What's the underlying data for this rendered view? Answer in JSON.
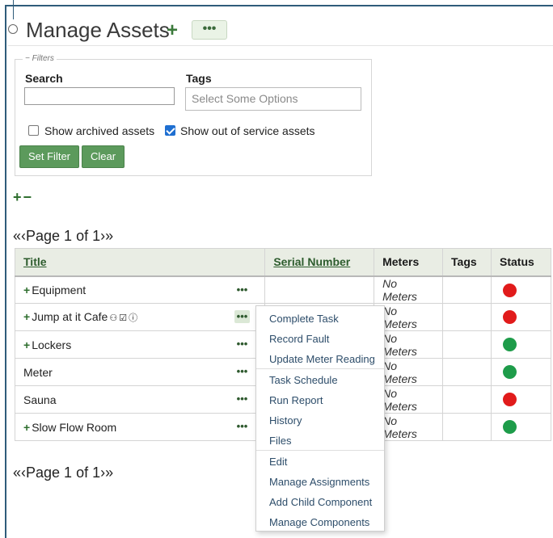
{
  "header": {
    "title": "Manage Assets",
    "add_symbol": "+",
    "more_symbol": "•••"
  },
  "filters": {
    "legend": "Filters",
    "search_label": "Search",
    "search_value": "",
    "tags_label": "Tags",
    "tags_placeholder": "Select Some Options",
    "show_archived_label": "Show archived assets",
    "show_archived_checked": false,
    "show_out_of_service_label": "Show out of service assets",
    "show_out_of_service_checked": true,
    "set_filter_label": "Set Filter",
    "clear_label": "Clear"
  },
  "expand_collapse": {
    "expand": "+",
    "collapse": "−"
  },
  "pager": {
    "first": "«",
    "prev": "‹",
    "text": "Page 1 of 1",
    "next": "›",
    "last": "»"
  },
  "table": {
    "columns": {
      "title": "Title",
      "serial": "Serial Number",
      "meters": "Meters",
      "tags": "Tags",
      "status": "Status"
    },
    "rows": [
      {
        "title": "Equipment",
        "has_children": true,
        "meters": "No Meters",
        "status_color": "#e11b1b"
      },
      {
        "title": "Jump at it Cafe",
        "has_children": true,
        "meters": "No Meters",
        "status_color": "#e11b1b",
        "icons": [
          "group-icon",
          "check-square-icon",
          "exclamation-circle-icon"
        ]
      },
      {
        "title": "Lockers",
        "has_children": true,
        "meters": "No Meters",
        "status_color": "#1e9c4a"
      },
      {
        "title": "Meter",
        "has_children": false,
        "meters": "No Meters",
        "status_color": "#1e9c4a"
      },
      {
        "title": "Sauna",
        "has_children": false,
        "meters": "No Meters",
        "status_color": "#e11b1b"
      },
      {
        "title": "Slow Flow Room",
        "has_children": true,
        "meters": "No Meters",
        "status_color": "#1e9c4a"
      }
    ],
    "row_more_symbol": "•••"
  },
  "context_menu": {
    "items": [
      "Complete Task",
      "Record Fault",
      "Update Meter Reading",
      "Task Schedule",
      "Run Report",
      "History",
      "Files",
      "Edit",
      "Manage Assignments",
      "Add Child Component",
      "Manage Components"
    ]
  },
  "colors": {
    "accent_green": "#5c9a5c",
    "status_red": "#e11b1b",
    "status_green": "#1e9c4a",
    "frame_blue": "#2f5c7a"
  }
}
